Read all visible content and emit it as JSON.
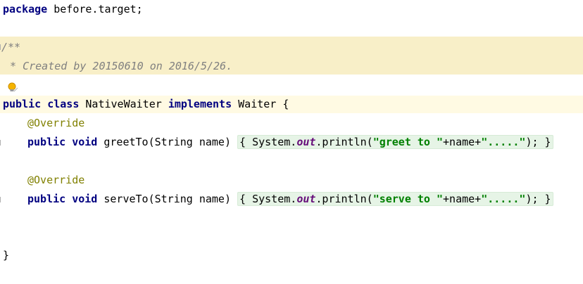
{
  "editor": {
    "line_package": {
      "keyword": "package",
      "rest": " before.target;"
    },
    "comment": {
      "open": "/**",
      "body": " * Created by 20150610 on 2016/5/26."
    },
    "class_decl": {
      "kw1": "public",
      "kw2": "class",
      "name": "NativeWaiter",
      "kw3": "implements",
      "iface": "Waiter",
      "brace": "{"
    },
    "methods": [
      {
        "annotation": "@Override",
        "kw_public": "public",
        "kw_void": "void",
        "signature": "greetTo(String name)",
        "body_start": "{ System.",
        "field": "out",
        "call": ".println(",
        "str1": "\"greet to \"",
        "concat": "+name+",
        "str2": "\".....\"",
        "end": "); }"
      },
      {
        "annotation": "@Override",
        "kw_public": "public",
        "kw_void": "void",
        "signature": "serveTo(String name)",
        "body_start": "{ System.",
        "field": "out",
        "call": ".println(",
        "str1": "\"serve to \"",
        "concat": "+name+",
        "str2": "\".....\"",
        "end": "); }"
      }
    ],
    "closing_brace": "}"
  },
  "colors": {
    "keyword": "#000080",
    "annotation": "#808000",
    "string": "#008000",
    "comment": "#808080",
    "comment_bg": "#f8efc8",
    "caret_line_bg": "#fffae3"
  },
  "icons": {
    "intention": "lightbulb-icon"
  }
}
